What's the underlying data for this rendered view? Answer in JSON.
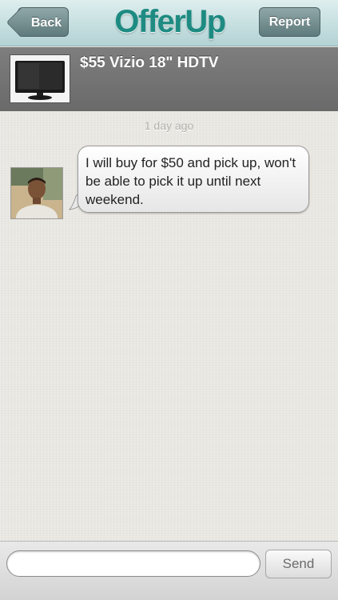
{
  "navbar": {
    "back_label": "Back",
    "logo_text": "OfferUp",
    "report_label": "Report",
    "accent": "#1e8b82"
  },
  "listing": {
    "title": "$55 Vizio 18\" HDTV",
    "thumb_icon": "tv-photo"
  },
  "chat": {
    "timestamp": "1 day ago",
    "messages": [
      {
        "sender_avatar": "user-avatar",
        "text": "I will buy for $50 and pick up, won't be able to pick it up until next weekend."
      }
    ]
  },
  "composer": {
    "input_value": "",
    "input_placeholder": "",
    "send_label": "Send"
  }
}
